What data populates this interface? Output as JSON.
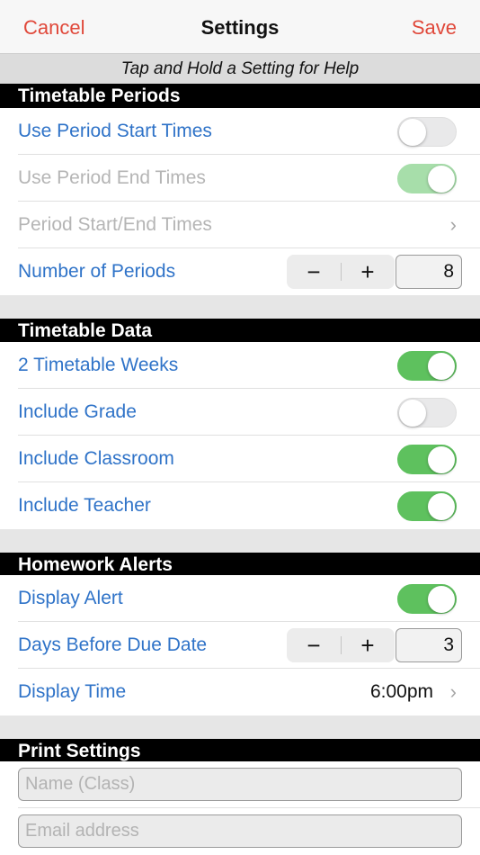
{
  "nav": {
    "cancel": "Cancel",
    "title": "Settings",
    "save": "Save"
  },
  "hint": "Tap and Hold a Setting for Help",
  "sections": {
    "periods": {
      "title": "Timetable Periods",
      "use_start_times": "Use Period Start Times",
      "use_end_times": "Use Period End Times",
      "start_end_times": "Period Start/End Times",
      "number_of_periods": "Number of Periods",
      "number_of_periods_value": "8"
    },
    "data": {
      "title": "Timetable Data",
      "two_weeks": "2 Timetable Weeks",
      "include_grade": "Include Grade",
      "include_classroom": "Include Classroom",
      "include_teacher": "Include Teacher"
    },
    "alerts": {
      "title": "Homework Alerts",
      "display_alert": "Display Alert",
      "days_before": "Days Before Due Date",
      "days_before_value": "3",
      "display_time": "Display Time",
      "display_time_value": "6:00pm"
    },
    "print": {
      "title": "Print Settings",
      "name_placeholder": "Name (Class)",
      "email_placeholder": "Email address"
    }
  },
  "toggles": {
    "use_start_times": false,
    "use_end_times": true,
    "two_weeks": true,
    "include_grade": false,
    "include_classroom": true,
    "include_teacher": true,
    "display_alert": true
  },
  "glyphs": {
    "minus": "−",
    "plus": "+",
    "chevron": "›"
  },
  "colors": {
    "accent": "#2f73c8",
    "nav_action": "#e0483a",
    "toggle_on": "#5ec15e"
  }
}
